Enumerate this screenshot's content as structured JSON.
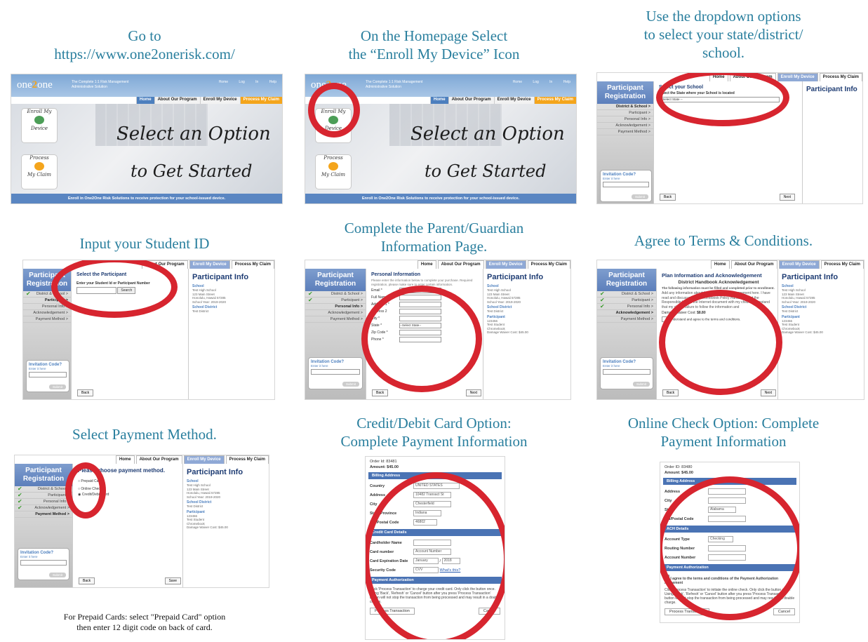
{
  "steps": [
    {
      "caption": "Go to\nhttps://www.one2onerisk.com/"
    },
    {
      "caption": "On the Homepage Select\nthe “Enroll My Device” Icon"
    },
    {
      "caption": "Use the dropdown options\nto select your state/district/\nschool."
    },
    {
      "caption": "Input your Student ID"
    },
    {
      "caption": "Complete the Parent/Guardian\nInformation Page."
    },
    {
      "caption": "Agree to Terms & Conditions."
    },
    {
      "caption": "Select Payment Method."
    },
    {
      "caption": "Credit/Debit Card Option:\nComplete Payment Information"
    },
    {
      "caption": "Online Check Option: Complete\nPayment Information"
    }
  ],
  "note": "For Prepaid Cards: select \"Prepaid Card\" option\nthen enter 12 digit code on back of card.",
  "home": {
    "logo_a": "one",
    "logo_b": "2",
    "logo_c": "one",
    "tagline": "The Complete 1:1 Risk Management Administrative Solution",
    "top_icons": "Home Log In Help",
    "nav": [
      "Home",
      "About Our Program",
      "Enroll My Device",
      "Process My Claim"
    ],
    "hero_line1": "Select an Option",
    "hero_line2": "to Get Started",
    "card1_top": "Enroll My",
    "card1_bottom": "Device",
    "card2_top": "Process",
    "card2_bottom": "My Claim",
    "footer": "Enroll in One2One Risk Solutions to receive protection for your school-issued device."
  },
  "reg": {
    "nav": [
      "Home",
      "About Our Program",
      "Enroll My Device",
      "Process My Claim"
    ],
    "side_title": "Participant Registration",
    "side_items": [
      "District & School >",
      "Participant >",
      "Personal Info >",
      "Acknowledgement >",
      "Payment Method >"
    ],
    "invitation": "Invitation Code?",
    "enter_here": "Enter it here",
    "submit": "Submit",
    "back": "Back",
    "next": "Next",
    "save": "Save",
    "participant_info": "Participant Info",
    "school_label": "School",
    "school_value": "Test High School\n123 Main Street\nHonolulu, Hawaii 57285\nSchool Year: 2019-2020",
    "district_label": "School District",
    "district_value": "Test District",
    "participant_label": "Participant",
    "participant_value": "123456\nTest Student\nChromebook\nDamage Waiver Cost: $45.00"
  },
  "s3": {
    "title": "Select your School",
    "label": "Select the State where your School is located",
    "select": "-- Select State --"
  },
  "s4": {
    "title": "Select the Participant",
    "label": "Enter your Student Id or Participant Number",
    "button": "Search"
  },
  "s5": {
    "title": "Personal Information",
    "intro": "Please enter the information below to complete your purchase. Required registration, please make sure to enter certain information.",
    "fields": [
      "Email *",
      "Full Name *",
      "Address 1 *",
      "Address 2",
      "City *",
      "State *",
      "Zip Code *",
      "Phone *"
    ],
    "state_select": "--Select State--"
  },
  "s6": {
    "title": "Plan Information and Acknowledgement",
    "subtitle": "District Handbook Acknowledgement",
    "text1": "The following information must be filled and completed prior to enrollment.",
    "text2": "Add any information about the technology use agreement here. I have read and discussed the Chromebook Policy Handbook and the Responsible Use of the Internet document with my child. I understand that my child's failure to follow the information and",
    "cost_label": "Damage Waiver Cost:",
    "cost_value": "$8.80",
    "agree": "I understand and agree to the terms and conditions."
  },
  "s7": {
    "title": "Please choose payment method.",
    "options": [
      "Prepaid Card",
      "Online Check",
      "Credit/Debit Card"
    ]
  },
  "s8": {
    "order": "Order Id: 83481",
    "amount": "Amount: $45.00",
    "billing": "Billing Address",
    "country_label": "Country",
    "country_value": "UNITED STATES",
    "address_label": "Address",
    "address_value": "10482 Transact St",
    "city_label": "City",
    "city_value": "Chesterfield",
    "state_label": "State/Province",
    "state_value": "Indiana",
    "zip_label": "Zip/Postal Code",
    "zip_value": "46802",
    "cc": "Credit Card Details",
    "holder_label": "Cardholder Name",
    "number_label": "Card number",
    "number_value": "Account Number",
    "exp_label": "Card Expiration Date",
    "exp_month": "January",
    "exp_year": "2018",
    "sec_label": "Security Code",
    "sec_value": "CVV",
    "whats_this": "What's this?",
    "auth": "Payment Authorization",
    "auth_text": "Click 'Process Transaction' to charge your credit card. Only click the button once. Using 'Back', 'Refresh' or 'Cancel' button after you press 'Process Transaction' button will not stop the transaction from being processed and may result in a double charge.",
    "process": "Process Transaction",
    "cancel": "Cancel"
  },
  "s9": {
    "order": "Order ID: 83480",
    "amount": "Amount: $45.00",
    "billing": "Billing Address",
    "address_label": "Address",
    "city_label": "City",
    "state_label": "State",
    "state_value": "Alabama",
    "zip_label": "Zip/Postal Code",
    "ach": "ACH Details",
    "type_label": "Account Type",
    "type_value": "Checking",
    "routing_label": "Routing Number",
    "account_label": "Account Number",
    "auth": "Payment Authorization",
    "agree": "I agree to the terms and conditions of the Payment Authorization Agreement",
    "auth_text": "Click 'Process Transaction' to initiate the online check. Only click the button once. Using 'Back', 'Refresh' or 'Cancel' button after you press 'Process Transaction' button will not stop the transaction from being processed and may result in a double charge.",
    "process": "Process Transaction",
    "cancel": "Cancel"
  }
}
